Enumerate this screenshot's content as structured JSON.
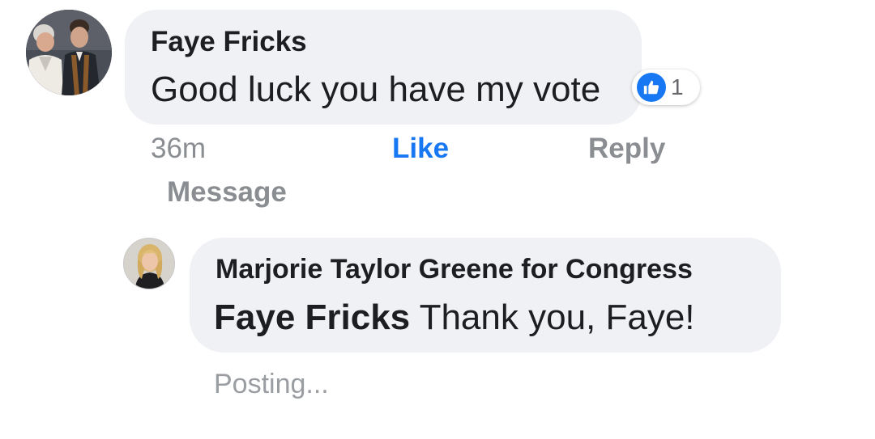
{
  "comment": {
    "author": "Faye Fricks",
    "text": "Good luck you have my vote",
    "reaction": {
      "icon": "like-icon",
      "count": "1",
      "color": "#1877f2"
    },
    "time": "36m",
    "actions": {
      "like": "Like",
      "reply": "Reply",
      "message": "Message"
    }
  },
  "reply": {
    "author": "Marjorie Taylor Greene for Congress",
    "mention": "Faye Fricks",
    "text": " Thank you, Faye!",
    "status": "Posting..."
  }
}
